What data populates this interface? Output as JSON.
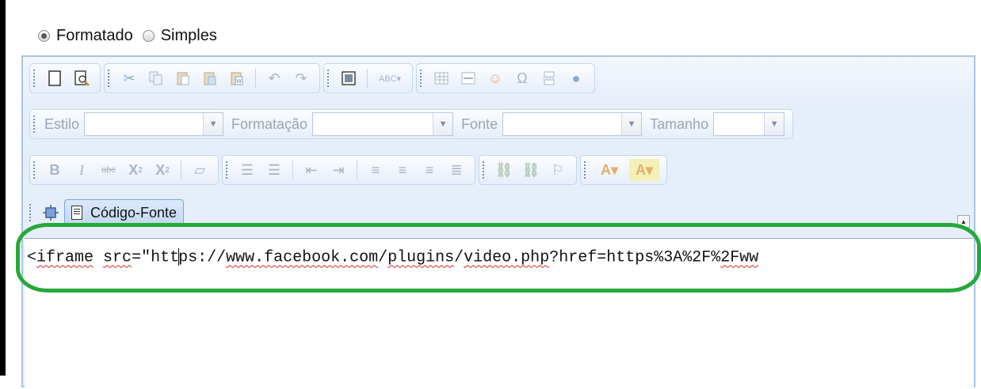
{
  "mode": {
    "options": [
      {
        "label": "Formatado",
        "selected": true
      },
      {
        "label": "Simples",
        "selected": false
      }
    ]
  },
  "toolbar": {
    "combos": {
      "style_label": "Estilo",
      "format_label": "Formatação",
      "font_label": "Fonte",
      "size_label": "Tamanho"
    },
    "source_label": "Código-Fonte"
  },
  "editor": {
    "code_parts": [
      "<",
      "iframe",
      " ",
      "src",
      "=\"htt",
      "ps://",
      "www.facebook.com",
      "/",
      "plugins",
      "/",
      "video.php",
      "?href=https%3A%2F%",
      "2Fww"
    ]
  },
  "colors": {
    "accent": "#a8c4e8",
    "highlight": "#26a83b",
    "spellcheck": "#d12a2a"
  }
}
